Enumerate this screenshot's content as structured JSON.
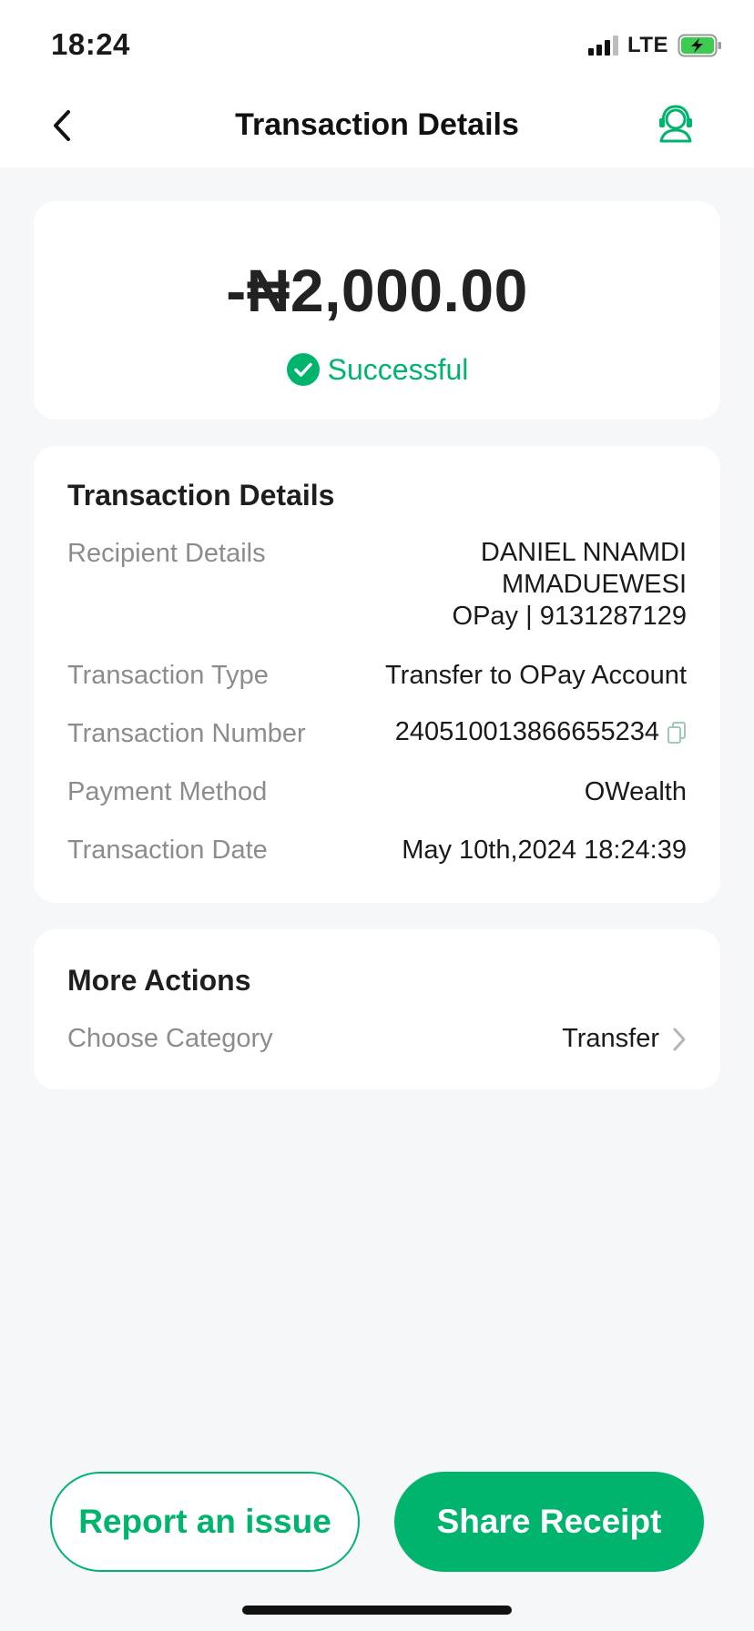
{
  "status_bar": {
    "time": "18:24",
    "network": "LTE",
    "icons": [
      "signal-icon",
      "battery-charging-icon"
    ]
  },
  "header": {
    "title": "Transaction Details",
    "back_icon": "chevron-left-icon",
    "support_icon": "customer-support-icon"
  },
  "summary": {
    "amount": "-₦2,000.00",
    "status": "Successful",
    "status_icon": "check-circle-icon"
  },
  "details": {
    "title": "Transaction Details",
    "recipient": {
      "label": "Recipient Details",
      "name_line1": "DANIEL NNAMDI",
      "name_line2": "MMADUEWESI",
      "account_line": "OPay | 9131287129"
    },
    "type": {
      "label": "Transaction Type",
      "value": "Transfer to OPay Account"
    },
    "number": {
      "label": "Transaction Number",
      "value": "240510013866655234",
      "icon": "copy-icon"
    },
    "method": {
      "label": "Payment Method",
      "value": "OWealth"
    },
    "date": {
      "label": "Transaction Date",
      "value": "May 10th,2024 18:24:39"
    }
  },
  "more_actions": {
    "title": "More Actions",
    "category_label": "Choose Category",
    "category_value": "Transfer",
    "icon": "chevron-right-icon"
  },
  "buttons": {
    "report": "Report an issue",
    "share": "Share Receipt"
  },
  "colors": {
    "accent": "#00b46e",
    "background": "#f6f7f9",
    "card": "#ffffff",
    "label": "#8c8c8c"
  }
}
